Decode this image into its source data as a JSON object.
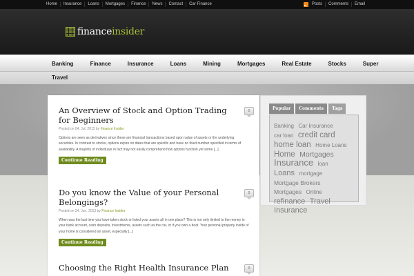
{
  "topnav": {
    "items": [
      "Home",
      "Insurance",
      "Loans",
      "Mortgages",
      "Finance",
      "News",
      "Contact",
      "Car Finance"
    ]
  },
  "rightnav": {
    "items": [
      "Posts",
      "Comments",
      "Email"
    ],
    "rss_icon": "rss-icon"
  },
  "logo": {
    "part1": "finance",
    "part2": "insider",
    "icon": "grid-logo-icon"
  },
  "mainnav": {
    "items": [
      "Banking",
      "Finance",
      "Insurance",
      "Loans",
      "Mining",
      "Mortgages",
      "Real Estate",
      "Stocks",
      "Super"
    ],
    "row2": "Travel"
  },
  "posts": [
    {
      "title": "An Overview of Stock and Option Trading for Beginners",
      "meta_prefix": "Posted on 04. Jul, 2013 by ",
      "author": "Finance Insider",
      "excerpt": "Options are seen as derivatives since these are financial transactions based upon value of assets or the underlying securities. In contrast to stocks, options expire on dates that are specific and have no fixed number specified in terms of availability. A majority of individuals in fact may not easily comprehend how options function yet some [...]",
      "button": "Continue Reading",
      "comments": "0"
    },
    {
      "title": "Do you know the Value of your Personal Belongings?",
      "meta_prefix": "Posted on 24. Jun, 2013 by ",
      "author": "Finance Insider",
      "excerpt": "When was the last time you have taken stock or listed your assets all in one place? This is not only limited to the money in your bank account, cash deposits, investments, assets such as the car, or if you own a boat. Your personal property inside of your home is considered an asset, especially [...]",
      "button": "Continue Reading",
      "comments": "0"
    },
    {
      "title": "Choosing the Right Health Insurance Plan",
      "comments": "0"
    }
  ],
  "sidebar": {
    "tabs": [
      "Popular",
      "Comments",
      "Tags"
    ],
    "tags": [
      {
        "text": "Banking",
        "size": 8
      },
      {
        "text": "Car Insurance",
        "size": 8
      },
      {
        "text": "car loan",
        "size": 8
      },
      {
        "text": "credit card",
        "size": 11.5
      },
      {
        "text": "home loan",
        "size": 11.5
      },
      {
        "text": "Home Loans",
        "size": 8
      },
      {
        "text": "Home",
        "size": 11.5
      },
      {
        "text": "Mortgages",
        "size": 10.5
      },
      {
        "text": "Insurance",
        "size": 13
      },
      {
        "text": "loan",
        "size": 8
      },
      {
        "text": "Loans",
        "size": 11
      },
      {
        "text": "mortgage",
        "size": 8
      },
      {
        "text": "Mortgage Brokers",
        "size": 8.5
      },
      {
        "text": "Mortgages",
        "size": 8.5
      },
      {
        "text": "Online",
        "size": 8
      },
      {
        "text": "refinance",
        "size": 11
      },
      {
        "text": "Travel",
        "size": 11
      },
      {
        "text": "Insurance",
        "size": 11
      }
    ],
    "tag_color": "#7e7e7e"
  },
  "colors": {
    "accent": "#a9bd3a",
    "button": "#6f8b1d",
    "topbar": "#101010"
  }
}
